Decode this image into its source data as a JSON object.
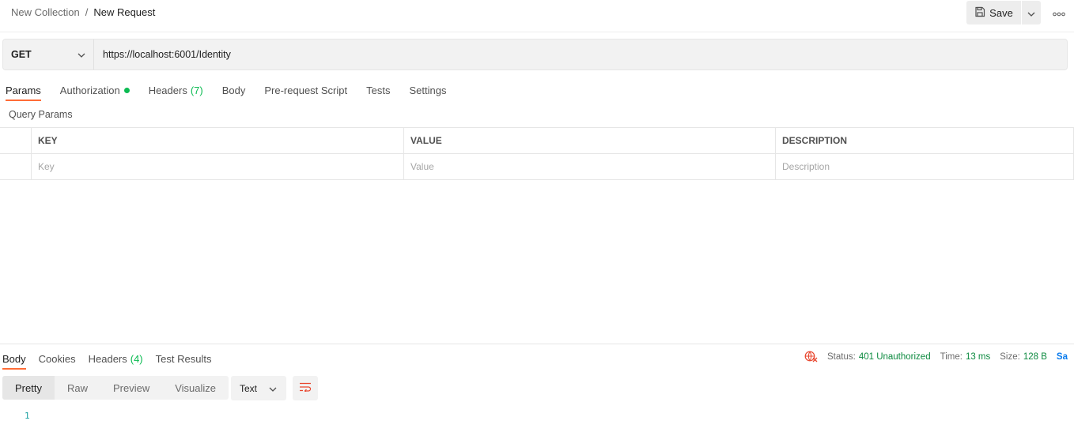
{
  "breadcrumb": {
    "collection": "New Collection",
    "separator": "/",
    "request": "New Request"
  },
  "toolbar": {
    "save_label": "Save",
    "save_icon": "save-icon",
    "caret_icon": "chevron-down-icon",
    "more_icon": "more-horizontal-icon"
  },
  "request": {
    "method": "GET",
    "url": "https://localhost:6001/Identity"
  },
  "request_tabs": [
    {
      "label": "Params",
      "active": true
    },
    {
      "label": "Authorization",
      "indicator": "green-dot"
    },
    {
      "label": "Headers",
      "count": "(7)"
    },
    {
      "label": "Body"
    },
    {
      "label": "Pre-request Script"
    },
    {
      "label": "Tests"
    },
    {
      "label": "Settings"
    }
  ],
  "query_params": {
    "title": "Query Params",
    "columns": [
      "KEY",
      "VALUE",
      "DESCRIPTION"
    ],
    "placeholders": {
      "key": "Key",
      "value": "Value",
      "description": "Description"
    }
  },
  "response": {
    "tabs": [
      {
        "label": "Body",
        "active": true
      },
      {
        "label": "Cookies"
      },
      {
        "label": "Headers",
        "count": "(4)"
      },
      {
        "label": "Test Results"
      }
    ],
    "status_label": "Status:",
    "status_value": "401 Unauthorized",
    "time_label": "Time:",
    "time_value": "13 ms",
    "size_label": "Size:",
    "size_value": "128 B",
    "save_partial": "Sa",
    "view_modes": [
      "Pretty",
      "Raw",
      "Preview",
      "Visualize"
    ],
    "active_view": "Pretty",
    "format": "Text",
    "line_numbers": [
      "1"
    ]
  },
  "colors": {
    "accent": "#ff6c37",
    "success": "#0cbb52",
    "status_green": "#0c8a3f",
    "link_blue": "#097bed",
    "error_icon": "#e8472f"
  }
}
